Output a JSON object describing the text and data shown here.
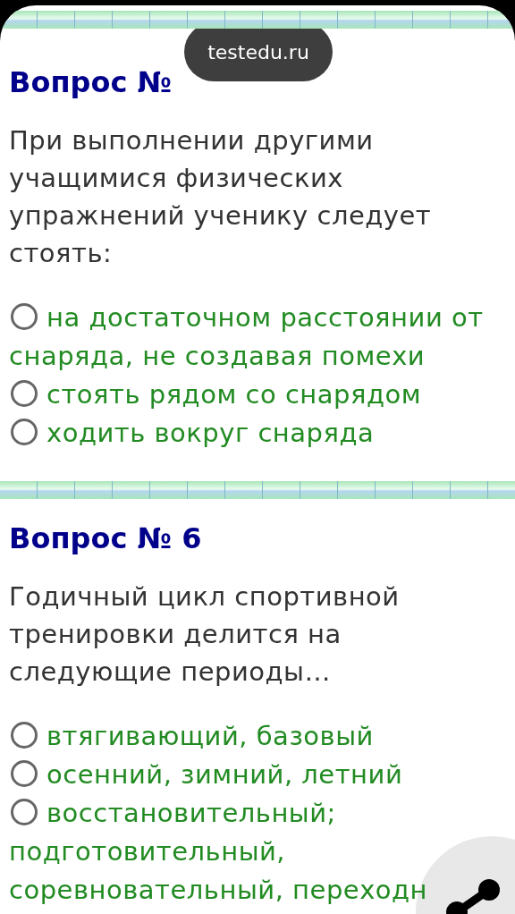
{
  "toast": {
    "text": "testedu.ru"
  },
  "questions": [
    {
      "title": "Вопрос №",
      "text": "При выполнении другими учащимися физических упражнений ученику следует стоять:",
      "options": [
        {
          "label": "на достаточном расстоянии от снаряда, не создавая помехи",
          "selected": false
        },
        {
          "label": "стоять рядом со снарядом",
          "selected": false
        },
        {
          "label": "ходить вокруг снаряда",
          "selected": false
        }
      ]
    },
    {
      "title": "Вопрос № 6",
      "text": "Годичный цикл спортивной тренировки делится на следующие периоды…",
      "options": [
        {
          "label": "втягивающий, базовый",
          "selected": false
        },
        {
          "label": "осенний, зимний, летний",
          "selected": false
        },
        {
          "label": "восстановительный; подготовительный, соревновательный, переходн",
          "selected": false
        }
      ]
    }
  ]
}
